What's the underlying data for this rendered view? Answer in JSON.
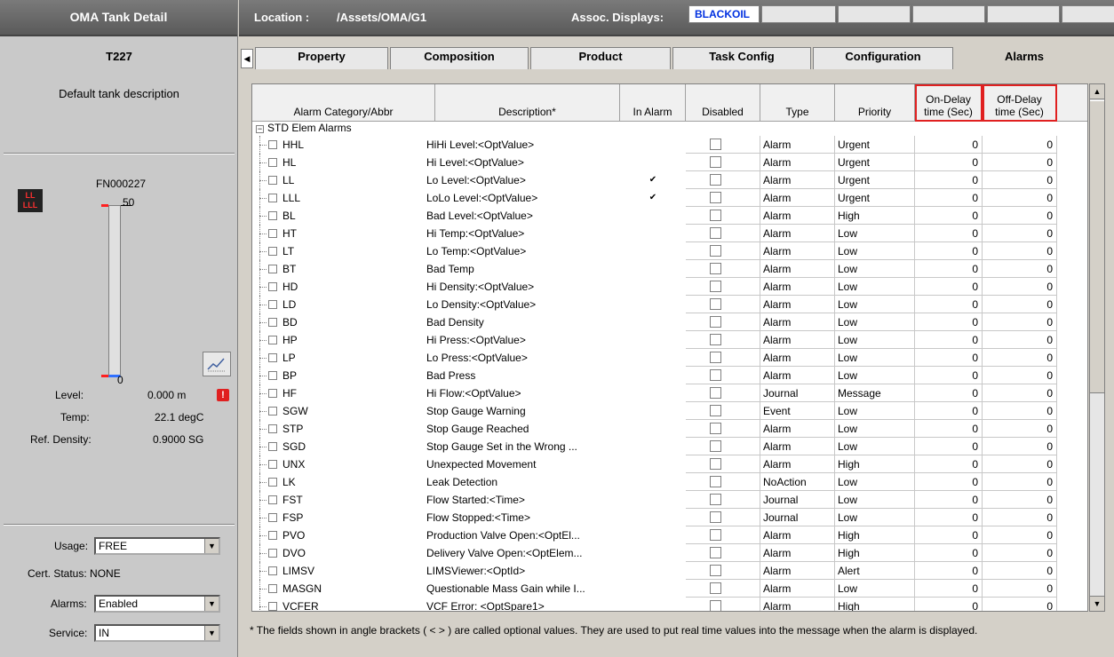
{
  "left_panel": {
    "title": "OMA Tank Detail",
    "tank_name": "T227",
    "tank_description": "Default tank description",
    "gauge_id": "FN000227",
    "gauge_max": "50",
    "gauge_min": "0",
    "alarm_indicator": "LL\nLLL",
    "stats": {
      "level_label": "Level:",
      "level_value": "0.000 m",
      "temp_label": "Temp:",
      "temp_value": "22.1 degC",
      "density_label": "Ref. Density:",
      "density_value": "0.9000 SG"
    },
    "usage_label": "Usage:",
    "usage_value": "FREE",
    "cert_status": "Cert. Status: NONE",
    "alarms_label": "Alarms:",
    "alarms_value": "Enabled",
    "service_label": "Service:",
    "service_value": "IN"
  },
  "header": {
    "location_label": "Location :",
    "location_value": "/Assets/OMA/G1",
    "assoc_label": "Assoc. Displays:",
    "assoc_first": "BLACKOIL"
  },
  "tabs": [
    "Property",
    "Composition",
    "Product",
    "Task Config",
    "Configuration",
    "Alarms"
  ],
  "table": {
    "columns": {
      "category": "Alarm Category/Abbr",
      "description": "Description*",
      "in_alarm": "In Alarm",
      "disabled": "Disabled",
      "type": "Type",
      "priority": "Priority",
      "on_delay_1": "On-Delay",
      "on_delay_2": "time (Sec)",
      "off_delay_1": "Off-Delay",
      "off_delay_2": "time (Sec)"
    },
    "group": "STD Elem Alarms",
    "rows": [
      {
        "abbr": "HHL",
        "desc": "HiHi Level:<OptValue>",
        "in_alarm": "",
        "type": "Alarm",
        "priority": "Urgent",
        "on": "0",
        "off": "0"
      },
      {
        "abbr": "HL",
        "desc": "Hi Level:<OptValue>",
        "in_alarm": "",
        "type": "Alarm",
        "priority": "Urgent",
        "on": "0",
        "off": "0"
      },
      {
        "abbr": "LL",
        "desc": "Lo Level:<OptValue>",
        "in_alarm": "✔",
        "type": "Alarm",
        "priority": "Urgent",
        "on": "0",
        "off": "0"
      },
      {
        "abbr": "LLL",
        "desc": "LoLo Level:<OptValue>",
        "in_alarm": "✔",
        "type": "Alarm",
        "priority": "Urgent",
        "on": "0",
        "off": "0"
      },
      {
        "abbr": "BL",
        "desc": "Bad Level:<OptValue>",
        "in_alarm": "",
        "type": "Alarm",
        "priority": "High",
        "on": "0",
        "off": "0"
      },
      {
        "abbr": "HT",
        "desc": "Hi Temp:<OptValue>",
        "in_alarm": "",
        "type": "Alarm",
        "priority": "Low",
        "on": "0",
        "off": "0"
      },
      {
        "abbr": "LT",
        "desc": "Lo Temp:<OptValue>",
        "in_alarm": "",
        "type": "Alarm",
        "priority": "Low",
        "on": "0",
        "off": "0"
      },
      {
        "abbr": "BT",
        "desc": "Bad Temp",
        "in_alarm": "",
        "type": "Alarm",
        "priority": "Low",
        "on": "0",
        "off": "0"
      },
      {
        "abbr": "HD",
        "desc": "Hi Density:<OptValue>",
        "in_alarm": "",
        "type": "Alarm",
        "priority": "Low",
        "on": "0",
        "off": "0"
      },
      {
        "abbr": "LD",
        "desc": "Lo Density:<OptValue>",
        "in_alarm": "",
        "type": "Alarm",
        "priority": "Low",
        "on": "0",
        "off": "0"
      },
      {
        "abbr": "BD",
        "desc": "Bad Density",
        "in_alarm": "",
        "type": "Alarm",
        "priority": "Low",
        "on": "0",
        "off": "0"
      },
      {
        "abbr": "HP",
        "desc": "Hi Press:<OptValue>",
        "in_alarm": "",
        "type": "Alarm",
        "priority": "Low",
        "on": "0",
        "off": "0"
      },
      {
        "abbr": "LP",
        "desc": "Lo Press:<OptValue>",
        "in_alarm": "",
        "type": "Alarm",
        "priority": "Low",
        "on": "0",
        "off": "0"
      },
      {
        "abbr": "BP",
        "desc": "Bad Press",
        "in_alarm": "",
        "type": "Alarm",
        "priority": "Low",
        "on": "0",
        "off": "0"
      },
      {
        "abbr": "HF",
        "desc": "Hi Flow:<OptValue>",
        "in_alarm": "",
        "type": "Journal",
        "priority": "Message",
        "on": "0",
        "off": "0"
      },
      {
        "abbr": "SGW",
        "desc": "Stop Gauge Warning",
        "in_alarm": "",
        "type": "Event",
        "priority": "Low",
        "on": "0",
        "off": "0"
      },
      {
        "abbr": "STP",
        "desc": "Stop Gauge Reached",
        "in_alarm": "",
        "type": "Alarm",
        "priority": "Low",
        "on": "0",
        "off": "0"
      },
      {
        "abbr": "SGD",
        "desc": "Stop Gauge Set in the Wrong ...",
        "in_alarm": "",
        "type": "Alarm",
        "priority": "Low",
        "on": "0",
        "off": "0"
      },
      {
        "abbr": "UNX",
        "desc": "Unexpected Movement",
        "in_alarm": "",
        "type": "Alarm",
        "priority": "High",
        "on": "0",
        "off": "0"
      },
      {
        "abbr": "LK",
        "desc": "Leak Detection",
        "in_alarm": "",
        "type": "NoAction",
        "priority": "Low",
        "on": "0",
        "off": "0"
      },
      {
        "abbr": "FST",
        "desc": "Flow Started:<Time>",
        "in_alarm": "",
        "type": "Journal",
        "priority": "Low",
        "on": "0",
        "off": "0"
      },
      {
        "abbr": "FSP",
        "desc": "Flow Stopped:<Time>",
        "in_alarm": "",
        "type": "Journal",
        "priority": "Low",
        "on": "0",
        "off": "0"
      },
      {
        "abbr": "PVO",
        "desc": "Production Valve Open:<OptEl...",
        "in_alarm": "",
        "type": "Alarm",
        "priority": "High",
        "on": "0",
        "off": "0"
      },
      {
        "abbr": "DVO",
        "desc": "Delivery Valve Open:<OptElem...",
        "in_alarm": "",
        "type": "Alarm",
        "priority": "High",
        "on": "0",
        "off": "0"
      },
      {
        "abbr": "LIMSV",
        "desc": "LIMSViewer:<OptId>",
        "in_alarm": "",
        "type": "Alarm",
        "priority": "Alert",
        "on": "0",
        "off": "0"
      },
      {
        "abbr": "MASGN",
        "desc": "Questionable Mass Gain while I...",
        "in_alarm": "",
        "type": "Alarm",
        "priority": "Low",
        "on": "0",
        "off": "0"
      },
      {
        "abbr": "VCFER",
        "desc": "VCF Error: <OptSpare1>",
        "in_alarm": "",
        "type": "Alarm",
        "priority": "High",
        "on": "0",
        "off": "0"
      }
    ]
  },
  "footnote": "* The fields shown in angle brackets ( < > ) are called optional values.  They are used to put real time values into the message when the alarm is displayed.",
  "colors": {
    "accent_highlight": "#e02020",
    "assoc_link": "#0030e0"
  }
}
